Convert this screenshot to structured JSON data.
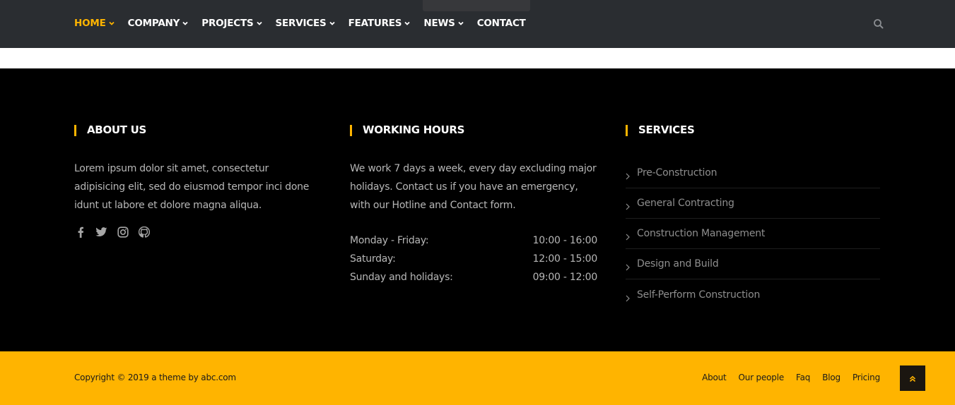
{
  "nav": {
    "items": [
      {
        "label": "Home",
        "has_dropdown": true,
        "active": true
      },
      {
        "label": "Company",
        "has_dropdown": true,
        "active": false
      },
      {
        "label": "Projects",
        "has_dropdown": true,
        "active": false
      },
      {
        "label": "Services",
        "has_dropdown": true,
        "active": false
      },
      {
        "label": "Features",
        "has_dropdown": true,
        "active": false
      },
      {
        "label": "News",
        "has_dropdown": true,
        "active": false
      },
      {
        "label": "Contact",
        "has_dropdown": false,
        "active": false
      }
    ],
    "search_icon": "search-icon"
  },
  "about": {
    "title": "ABOUT US",
    "text": "Lorem ipsum dolor sit amet, consectetur adipisicing elit, sed do eiusmod tempor inci done idunt ut labore et dolore magna aliqua.",
    "social_icons": [
      "facebook-icon",
      "twitter-icon",
      "instagram-icon",
      "github-icon"
    ]
  },
  "hours": {
    "title": "WORKING HOURS",
    "text": "We work 7 days a week, every day excluding major holidays. Contact us if you have an emergency, with our Hotline and Contact form.",
    "rows": [
      {
        "day": "Monday - Friday:",
        "time": "10:00 - 16:00"
      },
      {
        "day": "Saturday:",
        "time": "12:00 - 15:00"
      },
      {
        "day": "Sunday and holidays:",
        "time": "09:00 - 12:00"
      }
    ]
  },
  "services": {
    "title": "SERVICES",
    "items": [
      "Pre-Construction",
      "General Contracting",
      "Construction Management",
      "Design and Build",
      "Self-Perform Construction"
    ]
  },
  "footer_bottom": {
    "copyright": "Copyright © 2019 a theme by abc.com",
    "links": [
      "About",
      "Our people",
      "Faq",
      "Blog",
      "Pricing"
    ],
    "back_to_top_icon": "double-chevron-up-icon"
  },
  "colors": {
    "accent": "#ffb400",
    "nav_bg": "#2a2d31",
    "footer_bg": "#000000"
  }
}
